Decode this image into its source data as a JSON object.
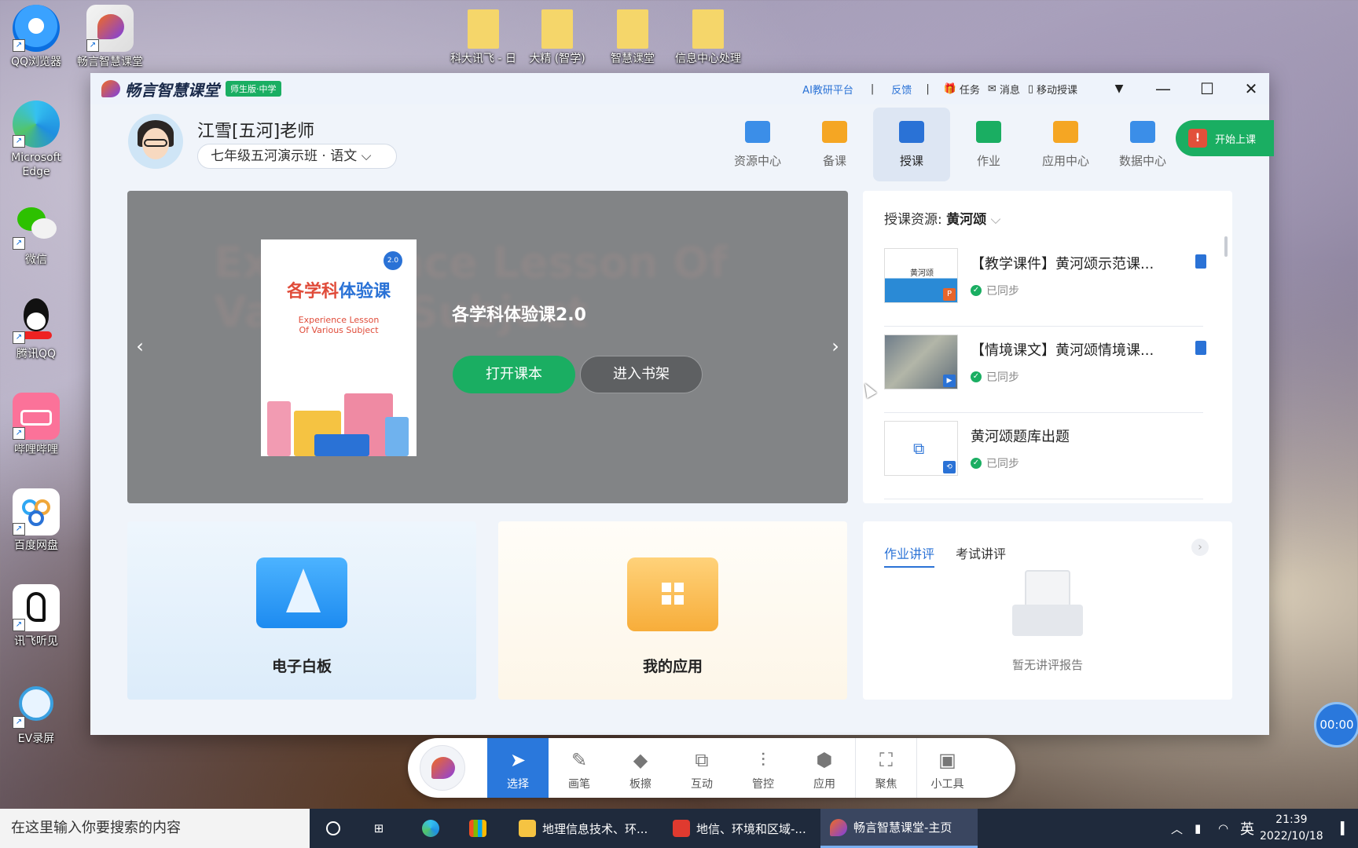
{
  "desktop": {
    "icons": [
      {
        "label": "QQ浏览器",
        "icon": "qq-browser-icon"
      },
      {
        "label": "畅言智慧课堂",
        "icon": "changyan-icon"
      },
      {
        "label": "Microsoft Edge",
        "icon": "edge-icon"
      },
      {
        "label": "微信",
        "icon": "wechat-icon"
      },
      {
        "label": "腾讯QQ",
        "icon": "qq-icon"
      },
      {
        "label": "哔哩哔哩",
        "icon": "bilibili-icon"
      },
      {
        "label": "百度网盘",
        "icon": "baidu-netdisk-icon"
      },
      {
        "label": "讯飞听见",
        "icon": "iflytek-icon"
      },
      {
        "label": "EV录屏",
        "icon": "ev-recorder-icon"
      }
    ],
    "files": [
      {
        "label": "科大讯飞 - 日"
      },
      {
        "label": "大精 (智学)"
      },
      {
        "label": "智慧课堂"
      },
      {
        "label": "信息中心处理"
      }
    ]
  },
  "app": {
    "brand": "畅言智慧课堂",
    "edition_badge": "师生版·中学",
    "links": {
      "ai": "AI教研平台",
      "feedback": "反馈",
      "sep": "|"
    },
    "menu": {
      "task": "任务",
      "message": "消息",
      "mobile": "移动授课"
    }
  },
  "header": {
    "teacher_name": "江雪[五河]老师",
    "class_select": "七年级五河演示班 · 语文",
    "nav": [
      {
        "label": "资源中心",
        "color": "#3b8ee8",
        "active": false
      },
      {
        "label": "备课",
        "color": "#f5a623",
        "active": false
      },
      {
        "label": "授课",
        "color": "#2a72d6",
        "active": true
      },
      {
        "label": "作业",
        "color": "#1aae62",
        "active": false
      },
      {
        "label": "应用中心",
        "color": "#f5a623",
        "active": false
      },
      {
        "label": "数据中心",
        "color": "#3b8ee8",
        "active": false
      }
    ],
    "start_class": "开始上课"
  },
  "banner": {
    "ghost_text": "Experience Lesson Of Various Subject",
    "cover_title_a": "各学科",
    "cover_title_b": "体验课",
    "cover_subtitle_1": "Experience Lesson",
    "cover_subtitle_2": "Of Various Subject",
    "cover_version": "2.0",
    "book_title": "各学科体验课2.0",
    "open_button": "打开课本",
    "shelf_button": "进入书架"
  },
  "resources": {
    "title_prefix": "授课资源: ",
    "title_topic": "黄河颂",
    "items": [
      {
        "name": "【教学课件】黄河颂示范课...",
        "status": "已同步",
        "thumb_text": "黄河颂"
      },
      {
        "name": "【情境课文】黄河颂情境课...",
        "status": "已同步",
        "thumb_text": ""
      },
      {
        "name": "黄河颂题库出题",
        "status": "已同步",
        "thumb_text": ""
      }
    ]
  },
  "cards": {
    "whiteboard": "电子白板",
    "my_apps": "我的应用"
  },
  "homework": {
    "tabs": [
      "作业讲评",
      "考试讲评"
    ],
    "empty": "暂无讲评报告"
  },
  "toolbar": {
    "tools": [
      {
        "label": "选择",
        "icon": "cursor-icon"
      },
      {
        "label": "画笔",
        "icon": "pen-icon"
      },
      {
        "label": "板擦",
        "icon": "eraser-icon"
      },
      {
        "label": "互动",
        "icon": "interact-icon"
      },
      {
        "label": "管控",
        "icon": "sliders-icon"
      },
      {
        "label": "应用",
        "icon": "box-icon"
      },
      {
        "label": "聚焦",
        "icon": "focus-icon"
      },
      {
        "label": "小工具",
        "icon": "toolbox-icon"
      }
    ],
    "timer": "00:00"
  },
  "taskbar": {
    "search_placeholder": "在这里输入你要搜索的内容",
    "apps": [
      {
        "label": "地理信息技术、环...",
        "color": "#f5c342"
      },
      {
        "label": "地信、环境和区域-...",
        "color": "#e03a2f"
      },
      {
        "label": "畅言智慧课堂-主页",
        "color": "#f26b21"
      }
    ],
    "ime": "英",
    "time": "21:39",
    "date": "2022/10/18"
  }
}
